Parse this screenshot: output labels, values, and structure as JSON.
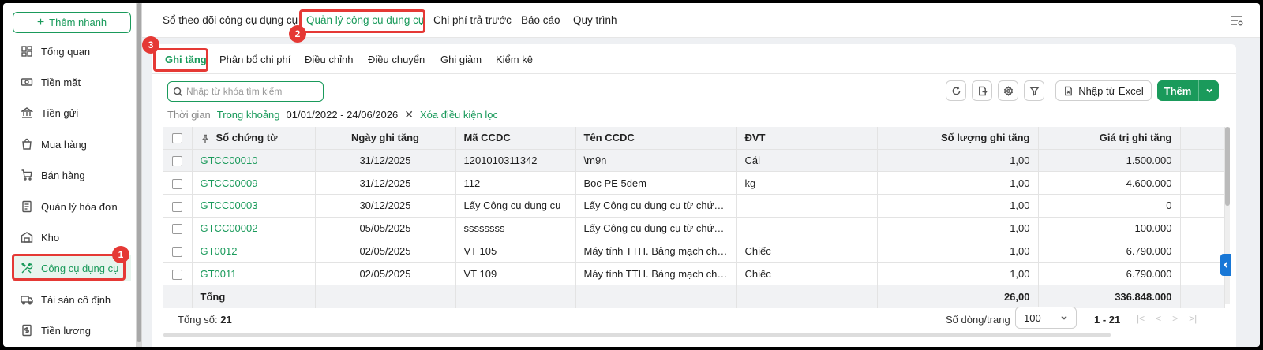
{
  "sidebar": {
    "quick_add": "Thêm nhanh",
    "items": [
      {
        "label": "Tổng quan",
        "icon": "dashboard-icon"
      },
      {
        "label": "Tiền mặt",
        "icon": "cash-icon"
      },
      {
        "label": "Tiền gửi",
        "icon": "bank-icon"
      },
      {
        "label": "Mua hàng",
        "icon": "shopping-bag-icon"
      },
      {
        "label": "Bán hàng",
        "icon": "cart-icon"
      },
      {
        "label": "Quản lý hóa đơn",
        "icon": "invoice-icon"
      },
      {
        "label": "Kho",
        "icon": "warehouse-icon"
      },
      {
        "label": "Công cụ dụng cụ",
        "icon": "tools-icon"
      },
      {
        "label": "Tài sản cố định",
        "icon": "truck-icon"
      },
      {
        "label": "Tiền lương",
        "icon": "payroll-icon"
      }
    ]
  },
  "top_tabs": [
    "Sổ theo dõi công cụ dụng cụ",
    "Quản lý công cụ dụng cụ",
    "Chi phí trả trước",
    "Báo cáo",
    "Quy trình"
  ],
  "sub_tabs": [
    "Ghi tăng",
    "Phân bổ chi phí",
    "Điều chỉnh",
    "Điều chuyển",
    "Ghi giảm",
    "Kiểm kê"
  ],
  "search": {
    "placeholder": "Nhập từ khóa tìm kiếm"
  },
  "filter": {
    "label": "Thời gian",
    "mode": "Trong khoảng",
    "range": "01/01/2022 - 24/06/2026",
    "clear": "Xóa điều kiện lọc"
  },
  "toolbar": {
    "import_label": "Nhập từ Excel",
    "add_label": "Thêm"
  },
  "table": {
    "headers": [
      "Số chứng từ",
      "Ngày ghi tăng",
      "Mã CCDC",
      "Tên CCDC",
      "ĐVT",
      "Số lượng ghi tăng",
      "Giá trị ghi tăng"
    ],
    "rows": [
      {
        "doc": "GTCC00010",
        "date": "31/12/2025",
        "code": "1201010311342",
        "name": "\\m9n",
        "unit": "Cái",
        "qty": "1,00",
        "value": "1.500.000"
      },
      {
        "doc": "GTCC00009",
        "date": "31/12/2025",
        "code": "112",
        "name": "Bọc PE 5dem",
        "unit": "kg",
        "qty": "1,00",
        "value": "4.600.000"
      },
      {
        "doc": "GTCC00003",
        "date": "30/12/2025",
        "code": "Lấy Công cụ dụng cụ",
        "name": "Lấy Công cụ dụng cụ từ chứng...",
        "unit": "",
        "qty": "1,00",
        "value": "0"
      },
      {
        "doc": "GTCC00002",
        "date": "05/05/2025",
        "code": "ssssssss",
        "name": "Lấy Công cụ dụng cụ từ chứng...",
        "unit": "",
        "qty": "1,00",
        "value": "100.000"
      },
      {
        "doc": "GT0012",
        "date": "02/05/2025",
        "code": "VT 105",
        "name": "Máy tính TTH. Bảng mạch chín...",
        "unit": "Chiếc",
        "qty": "1,00",
        "value": "6.790.000"
      },
      {
        "doc": "GT0011",
        "date": "02/05/2025",
        "code": "VT 109",
        "name": "Máy tính TTH. Bảng mạch chín...",
        "unit": "Chiếc",
        "qty": "1,00",
        "value": "6.790.000"
      }
    ],
    "total_label": "Tổng",
    "total_qty": "26,00",
    "total_value": "336.848.000"
  },
  "footer": {
    "count_label": "Tổng số:",
    "count": "21",
    "rows_per_page_label": "Số dòng/trang",
    "rows_per_page": "100",
    "range": "1 - 21"
  },
  "annotations": [
    "1",
    "2",
    "3"
  ],
  "colors": {
    "accent": "#1a9a5b",
    "annotation": "#e53935",
    "side_tab": "#1877d6"
  }
}
